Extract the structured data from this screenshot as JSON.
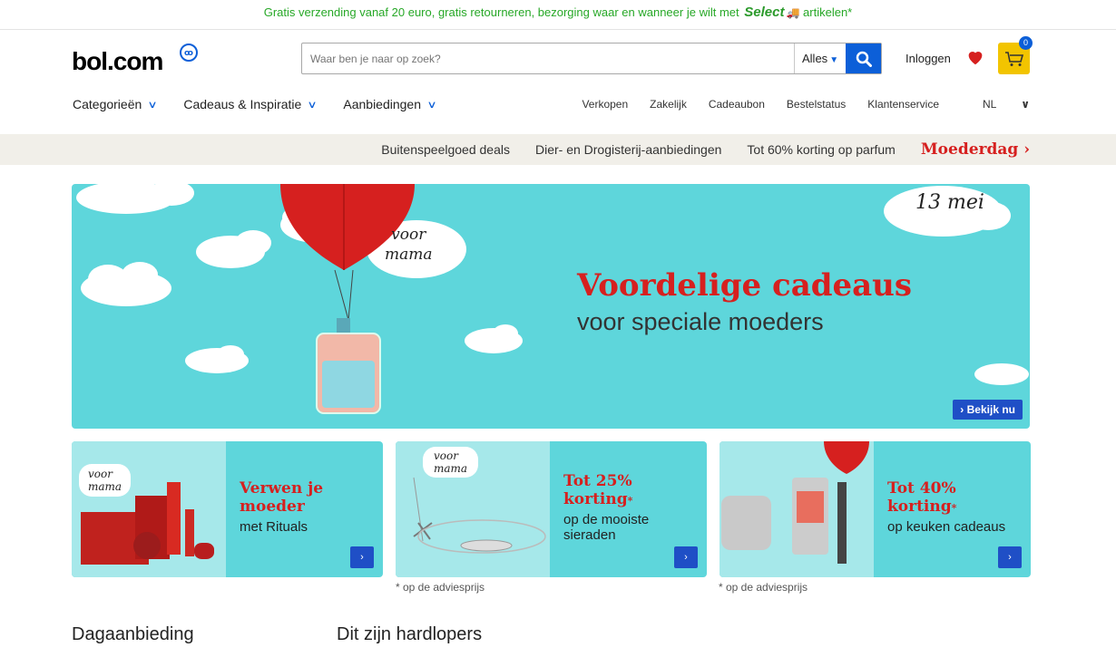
{
  "promo": {
    "text_before": "Gratis verzending vanaf 20 euro, gratis retourneren, bezorging waar en wanneer je wilt met",
    "select_label": "Select",
    "text_after": "artikelen*"
  },
  "header": {
    "logo": "bol.com",
    "logo_badge": "ꝏ",
    "search_placeholder": "Waar ben je naar op zoek?",
    "search_scope": "Alles",
    "login": "Inloggen",
    "cart_count": "0"
  },
  "nav": {
    "main": [
      "Categorieën",
      "Cadeaus & Inspiratie",
      "Aanbiedingen"
    ],
    "right": [
      "Verkopen",
      "Zakelijk",
      "Cadeaubon",
      "Bestelstatus",
      "Klantenservice",
      "NL"
    ]
  },
  "subbar": {
    "links": [
      "Buitenspeelgoed deals",
      "Dier- en Drogisterij-aanbiedingen",
      "Tot 60% korting op parfum"
    ],
    "highlight": "Moederdag"
  },
  "hero": {
    "title": "Voordelige cadeaus",
    "subtitle": "voor speciale moeders",
    "date": "13 mei",
    "tag_line1": "voor",
    "tag_line2": "mama",
    "cta": "Bekijk nu"
  },
  "cards": [
    {
      "red1": "Verwen je",
      "red2": "moeder",
      "text1": "met Rituals",
      "text2": "",
      "tag1": "voor",
      "tag2": "mama"
    },
    {
      "red1": "Tot 25%",
      "red2": "korting",
      "text1": "op de mooiste",
      "text2": "sieraden",
      "tag1": "voor",
      "tag2": "mama"
    },
    {
      "red1": "Tot 40%",
      "red2": "korting",
      "text1": "op keuken cadeaus",
      "text2": "",
      "tag1": "",
      "tag2": ""
    }
  ],
  "footnotes": [
    "* op de adviesprijs",
    "* op de adviesprijs"
  ],
  "sections": [
    "Dagaanbieding",
    "Dit zijn hardlopers"
  ],
  "colors": {
    "brand_blue": "#0c5fd8",
    "accent_red": "#d6201f",
    "promo_green": "#27a827",
    "hero_bg": "#5ed6db",
    "cart_yellow": "#f2c400"
  }
}
